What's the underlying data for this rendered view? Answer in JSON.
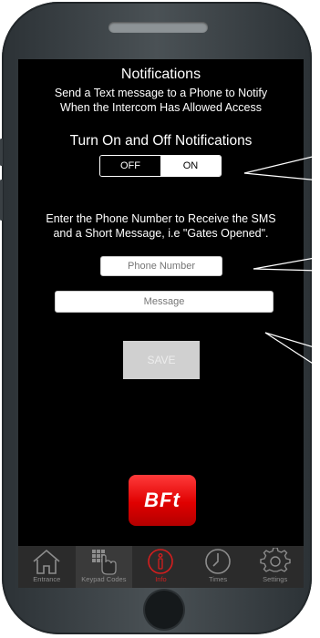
{
  "header": {
    "title": "Notifications",
    "subtitle_line1": "Send a Text message to  a Phone to Notify",
    "subtitle_line2": "When the Intercom Has Allowed Access"
  },
  "toggle": {
    "heading": "Turn On and Off Notifications",
    "off_label": "OFF",
    "on_label": "ON",
    "selected": "ON"
  },
  "phone_section": {
    "heading_line1": "Enter the Phone Number to Receive the SMS",
    "heading_line2": "and a Short Message, i.e \"Gates Opened\".",
    "phone_placeholder": "Phone Number",
    "message_placeholder": "Message",
    "save_label": "SAVE"
  },
  "logo": {
    "text": "BFt"
  },
  "tabs": [
    {
      "label": "Entrance",
      "icon": "house-icon"
    },
    {
      "label": "Keypad Codes",
      "icon": "keypad-icon"
    },
    {
      "label": "Info",
      "icon": "info-icon",
      "active": true
    },
    {
      "label": "Times",
      "icon": "clock-icon"
    },
    {
      "label": "Settings",
      "icon": "gear-icon"
    }
  ],
  "colors": {
    "accent": "#d41e1e",
    "screen_bg": "#000000",
    "tabbar_bg": "#2b2b2b"
  }
}
